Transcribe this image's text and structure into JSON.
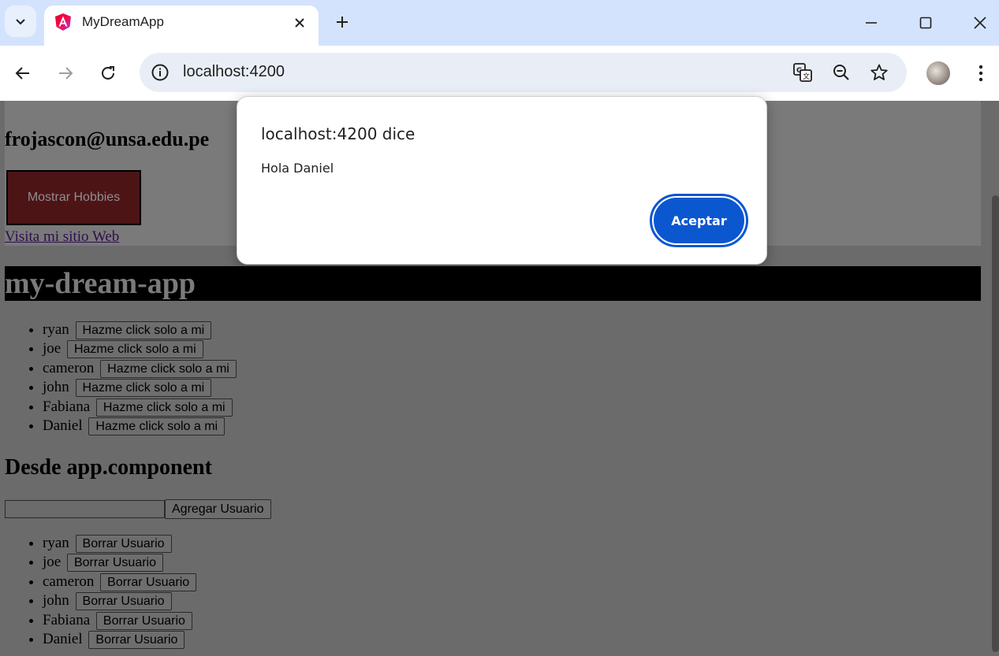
{
  "browser": {
    "tab_title": "MyDreamApp",
    "url": "localhost:4200",
    "icons": [
      "tab-search-chevron-icon",
      "angular-logo-icon",
      "close-tab-icon",
      "new-tab-icon",
      "minimize-icon",
      "maximize-icon",
      "close-window-icon",
      "back-icon",
      "forward-icon",
      "reload-icon",
      "site-info-icon",
      "translate-icon",
      "zoom-out-icon",
      "bookmark-star-icon",
      "profile-avatar",
      "more-menu-icon"
    ]
  },
  "profile": {
    "email": "frojascon@unsa.edu.pe",
    "hobbies_button": "Mostrar Hobbies",
    "site_link": "Visita mi sitio Web"
  },
  "app": {
    "title": "my-dream-app",
    "click_button_label": "Hazme click solo a mi",
    "users": [
      "ryan",
      "joe",
      "cameron",
      "john",
      "Fabiana",
      "Daniel"
    ],
    "section_title": "Desde app.component",
    "add_input_value": "",
    "add_button": "Agregar Usuario",
    "delete_button_label": "Borrar Usuario"
  },
  "dialog": {
    "title": "localhost:4200 dice",
    "message": "Hola Daniel",
    "ok_button": "Aceptar"
  },
  "colors": {
    "accent": "#0b57d0",
    "titlebar": "#d3e3fd",
    "overlay_page": "#6b6b6b",
    "hobbies_button_bg": "#4d1416"
  }
}
